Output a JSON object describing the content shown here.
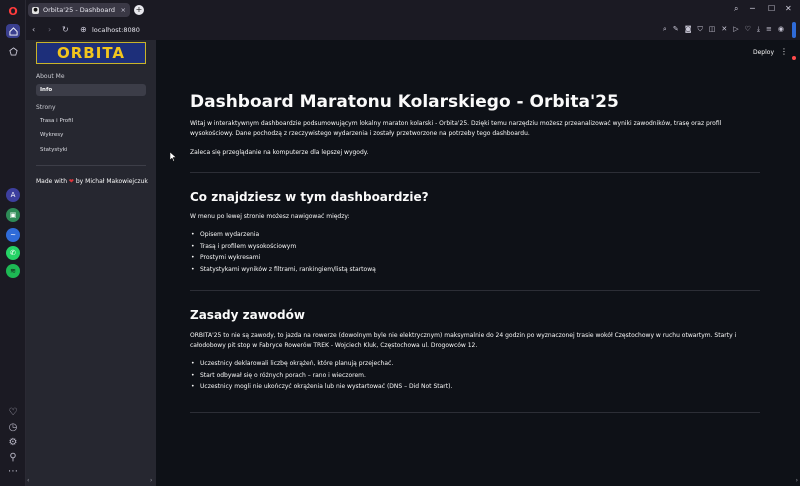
{
  "browser": {
    "tab_title": "Orbita'25 - Dashboard",
    "url": "localhost:8080",
    "new_tab_symbol": "+",
    "tab_close_symbol": "×"
  },
  "app": {
    "deploy_label": "Deploy",
    "logo_text": "ORBITA"
  },
  "sidebar": {
    "section_about": "About Me",
    "item_info": "Info",
    "section_pages": "Strony",
    "pages": [
      "Trasa i Profil",
      "Wykresy",
      "Statystyki"
    ],
    "made_with_prefix": "Made with",
    "made_with_suffix": "by Michał Makowiejczuk"
  },
  "main": {
    "title": "Dashboard Maratonu Kolarskiego - Orbita'25",
    "intro": "Witaj w interaktywnym dashboardzie podsumowującym lokalny maraton kolarski - Orbita'25. Dzięki temu narzędziu możesz przeanalizować wyniki zawodników, trasę oraz profil wysokościowy. Dane pochodzą z rzeczywistego wydarzenia i zostały przetworzone na potrzeby tego dashboardu.",
    "note": "Zaleca się przeglądanie na komputerze dla lepszej wygody.",
    "section1_title": "Co znajdziesz w tym dashboardzie?",
    "section1_lead": "W menu po lewej stronie możesz nawigować między:",
    "section1_items": [
      "Opisem wydarzenia",
      "Trasą i profilem wysokościowym",
      "Prostymi wykresami",
      "Statystykami wyników z filtrami, rankingiem/listą startową"
    ],
    "section2_title": "Zasady zawodów",
    "section2_text": "ORBITA'25 to nie są zawody, to jazda na rowerze (dowolnym byle nie elektrycznym) maksymalnie do 24 godzin po wyznaczonej trasie wokół Częstochowy w ruchu otwartym. Starty i całodobowy pit stop w Fabryce Rowerów TREK - Wojciech Kluk, Częstochowa ul. Drogowców 12.",
    "section2_items": [
      "Uczestnicy deklarowali liczbę okrążeń, które planują przejechać.",
      "Start odbywał się o różnych porach – rano i wieczorem.",
      "Uczestnicy mogli nie ukończyć okrążenia lub nie wystartować (DNS – Did Not Start)."
    ]
  }
}
